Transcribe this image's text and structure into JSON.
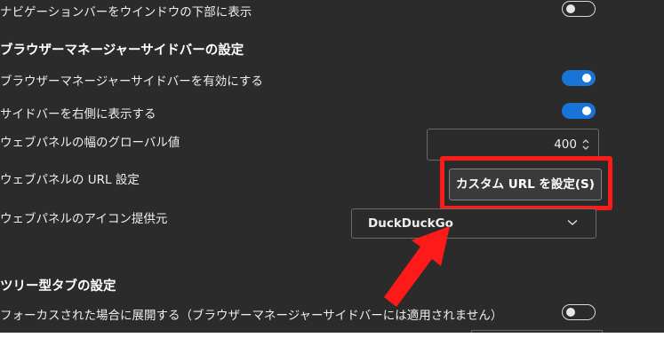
{
  "settings": {
    "nav_bar_bottom": {
      "label": "ナビゲーションバーをウインドウの下部に表示",
      "state": "off"
    },
    "sidebar_section_title": "ブラウザーマネージャーサイドバーの設定",
    "enable_sidebar": {
      "label": "ブラウザーマネージャーサイドバーを有効にする",
      "state": "on"
    },
    "sidebar_right": {
      "label": "サイドバーを右側に表示する",
      "state": "on"
    },
    "web_panel_width": {
      "label": "ウェブパネルの幅のグローバル値",
      "value": "400"
    },
    "web_panel_url": {
      "label": "ウェブパネルの URL 設定",
      "button_label": "カスタム URL を設定(S)"
    },
    "web_panel_icon": {
      "label": "ウェブパネルのアイコン提供元",
      "selected": "DuckDuckGo"
    },
    "tree_tab_section_title": "ツリー型タブの設定",
    "expand_on_focus": {
      "label": "フォーカスされた場合に展開する（ブラウザーマネージャーサイドバーには適用されません）",
      "state": "off"
    }
  },
  "colors": {
    "background": "#2b2b2b",
    "toggle_on": "#1a73d6",
    "highlight": "#ff1a1a"
  },
  "icons": {
    "spinner": "spin-updown-icon",
    "dropdown": "chevron-down-icon",
    "annotation": "red-arrow-icon"
  }
}
